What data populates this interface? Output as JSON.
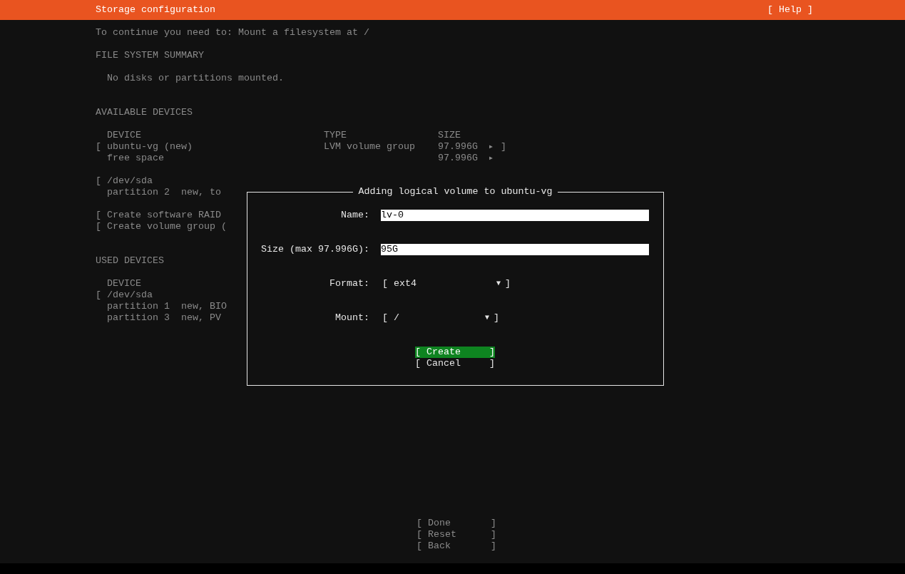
{
  "header": {
    "title": "Storage configuration",
    "help": "[ Help ]"
  },
  "instruction": "To continue you need to: Mount a filesystem at /",
  "file_system_summary": {
    "title": "FILE SYSTEM SUMMARY",
    "message": "No disks or partitions mounted."
  },
  "available_devices": {
    "title": "AVAILABLE DEVICES",
    "columns": [
      "DEVICE",
      "TYPE",
      "SIZE"
    ],
    "groups": [
      [
        {
          "open": "[",
          "name": "ubuntu-vg (new)",
          "type": "LVM volume group",
          "size": "97.996G",
          "arrow": "▶",
          "close": "]"
        },
        {
          "name": "free space",
          "size": "97.996G",
          "arrow": "▶"
        }
      ],
      [
        {
          "open": "[",
          "name": "/dev/sda"
        },
        {
          "name": "partition 2  new, to"
        }
      ],
      [
        {
          "open": "[",
          "name": "Create software RAID"
        },
        {
          "open": "[",
          "name": "Create volume group ("
        }
      ]
    ]
  },
  "used_devices": {
    "title": "USED DEVICES",
    "columns": [
      "DEVICE"
    ],
    "groups": [
      [
        {
          "open": "[",
          "name": "/dev/sda"
        },
        {
          "name": "partition 1  new, BIO"
        },
        {
          "name": "partition 3  new, PV"
        }
      ]
    ]
  },
  "dialog": {
    "title": "Adding logical volume to ubuntu-vg",
    "fields": [
      {
        "kind": "text",
        "label": "Name:",
        "value": "lv-0"
      },
      {
        "kind": "text",
        "label": "Size (max 97.996G):",
        "value": "95G"
      },
      {
        "kind": "dropdown",
        "label": "Format:",
        "open": "[",
        "value": "ext4",
        "arrow": "▼",
        "close": "]"
      },
      {
        "kind": "dropdown",
        "label": "Mount:",
        "open": "[",
        "value": "/",
        "arrow": "▼",
        "close": "]"
      }
    ],
    "buttons": [
      {
        "open": "[",
        "label": "Create",
        "close": "]",
        "selected": true
      },
      {
        "open": "[",
        "label": "Cancel",
        "close": "]",
        "selected": false
      }
    ]
  },
  "buttons": [
    {
      "open": "[",
      "label": "Done",
      "close": "]",
      "selected": false
    },
    {
      "open": "[",
      "label": "Reset",
      "close": "]",
      "selected": false
    },
    {
      "open": "[",
      "label": "Back",
      "close": "]",
      "selected": false
    }
  ]
}
